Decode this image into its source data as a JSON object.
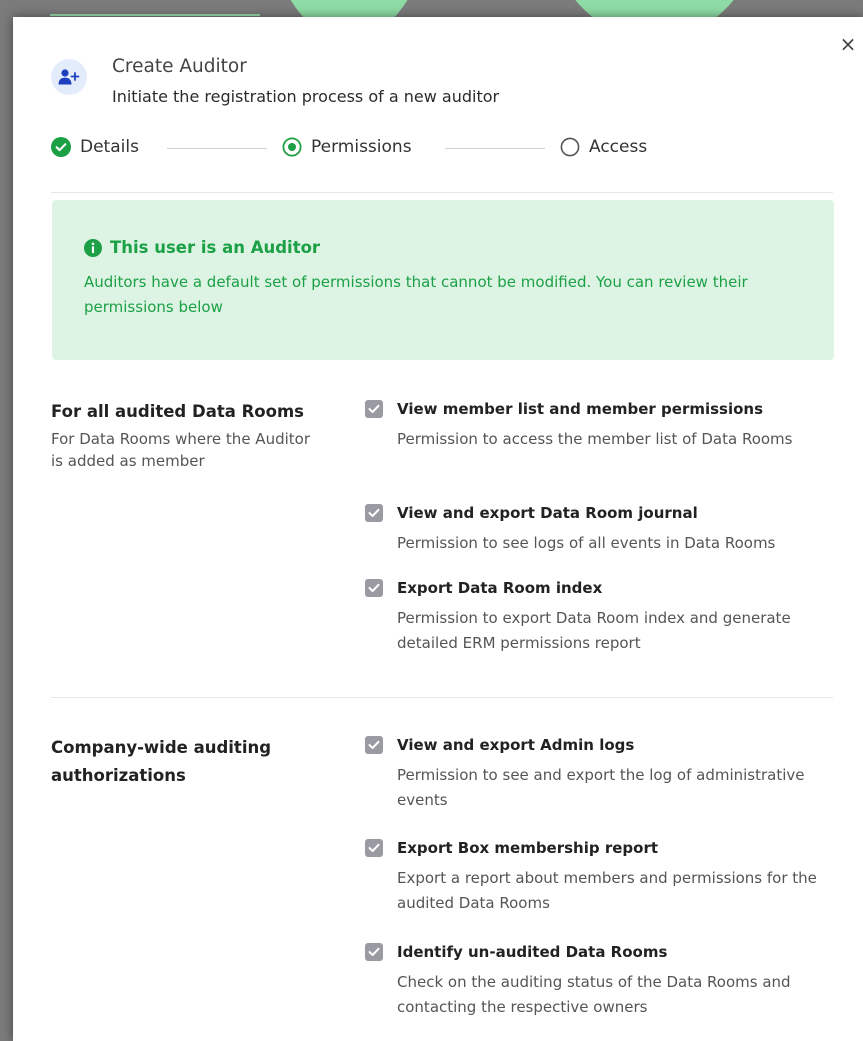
{
  "dialog": {
    "title": "Create Auditor",
    "subtitle": "Initiate the registration process of a new auditor",
    "close_symbol": "×"
  },
  "stepper": {
    "steps": [
      {
        "label": "Details",
        "state": "completed",
        "icon": "check-circle-icon"
      },
      {
        "label": "Permissions",
        "state": "current",
        "icon": "radio-selected-icon"
      },
      {
        "label": "Access",
        "state": "pending",
        "icon": "radio-empty-icon"
      }
    ]
  },
  "notice": {
    "title": "This user is an Auditor",
    "body": "Auditors have a default set of permissions that cannot be modified. You can review their permissions below",
    "icon": "info-icon",
    "color": "#1ca046",
    "background": "#ddf4e4"
  },
  "sections": [
    {
      "title": "For all audited Data Rooms",
      "subtitle": "For Data Rooms where the Auditor is added as member",
      "permissions": [
        {
          "title": "View member list and member permissions",
          "description": "Permission to access the member list of Data Rooms",
          "checked": true
        },
        {
          "title": "View and export Data Room journal",
          "description": "Permission to see logs of all events in Data Rooms",
          "checked": true
        },
        {
          "title": "Export Data Room index",
          "description": "Permission to export Data Room index and generate detailed ERM permissions report",
          "checked": true
        }
      ]
    },
    {
      "title": "Company-wide auditing authorizations",
      "subtitle": "",
      "permissions": [
        {
          "title": "View and export Admin logs",
          "description": "Permission to see and export the log of administrative events",
          "checked": true
        },
        {
          "title": "Export Box membership report",
          "description": "Export a report about members and permissions for the audited Data Rooms",
          "checked": true
        },
        {
          "title": "Identify un-audited Data Rooms",
          "description": "Check on the auditing status of the Data Rooms and contacting the respective owners",
          "checked": true
        }
      ]
    }
  ],
  "colors": {
    "accent_green": "#1ca046",
    "checkbox_gray": "#9a9aa3",
    "avatar_bg": "#e3ecfb",
    "avatar_icon": "#1d3fbf"
  }
}
